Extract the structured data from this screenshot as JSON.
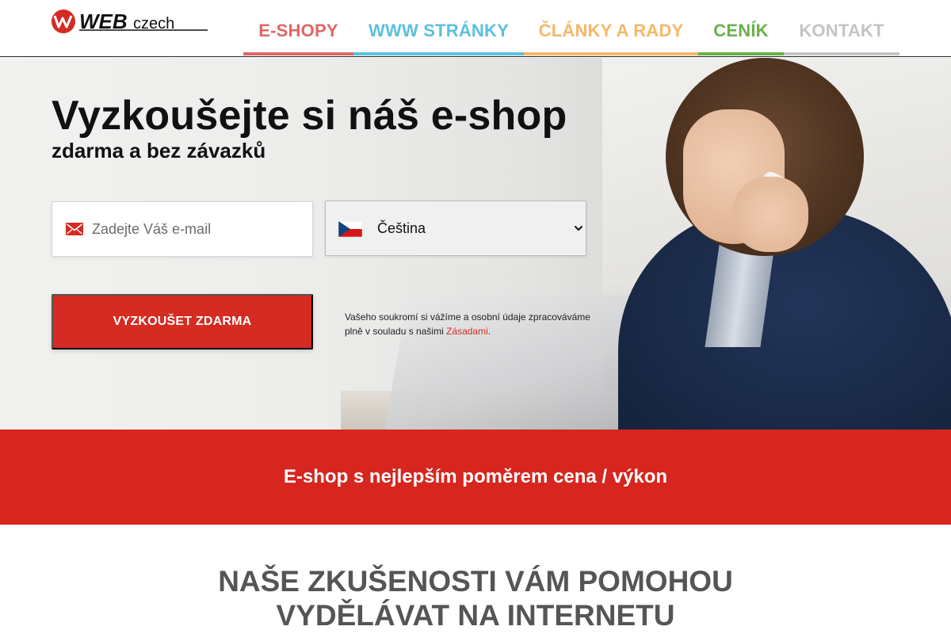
{
  "header": {
    "logo": {
      "text": "WEBczech",
      "icon": "webczech-logo-icon",
      "brand_color": "#d42b22"
    },
    "nav": [
      {
        "label": "E-SHOPY",
        "color": "#e06666"
      },
      {
        "label": "WWW STRÁNKY",
        "color": "#5bc0de"
      },
      {
        "label": "ČLÁNKY A RADY",
        "color": "#f5b866"
      },
      {
        "label": "CENÍK",
        "color": "#6ab04c"
      },
      {
        "label": "KONTAKT",
        "color": "#c4c4c4"
      }
    ]
  },
  "hero": {
    "title": "Vyzkoušejte si náš e-shop",
    "subtitle": "zdarma a bez závazků",
    "email": {
      "placeholder": "Zadejte Váš e-mail",
      "value": "",
      "icon": "envelope-icon"
    },
    "language": {
      "selected": "Čeština",
      "flag_icon": "czech-flag-icon"
    },
    "cta_label": "VYZKOUŠET ZDARMA",
    "privacy": {
      "text": "Vašeho soukromí si vážíme a osobní údaje zpracováváme plně v souladu s našimi ",
      "link_label": "Zásadami",
      "suffix": "."
    }
  },
  "band": {
    "text": "E-shop s nejlepším poměrem cena / výkon",
    "color": "#d6261f"
  },
  "experience": {
    "line1": "NAŠE ZKUŠENOSTI VÁM POMOHOU",
    "line2": "VYDĚLÁVAT NA INTERNETU"
  }
}
